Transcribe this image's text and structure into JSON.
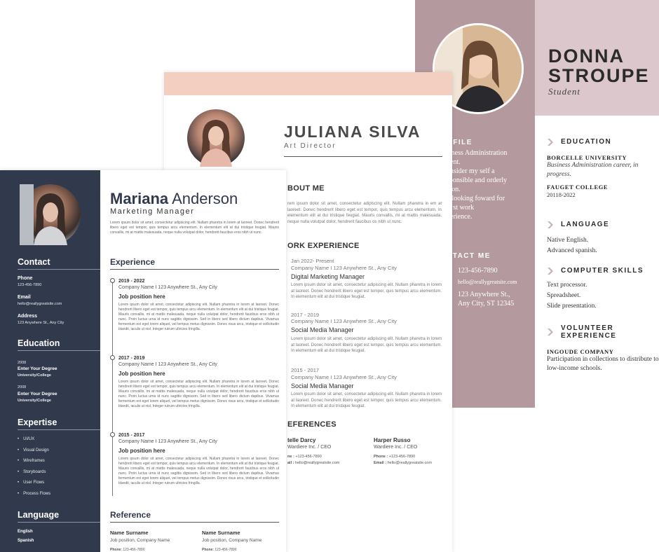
{
  "resume_c": {
    "name": "DONNA STROUPE",
    "role": "Student",
    "profile_head": "OFILE",
    "profile_lines": [
      "siness Administration",
      "dent.",
      "onsider my self a",
      "sponsible and orderly",
      "rson.",
      "n looking foward for",
      "first work",
      "perience."
    ],
    "contact_head": "NTACT ME",
    "contact_lines": [
      "123-456-7890",
      "hello@reallygreatsite.com",
      "123 Anywhere St.,",
      "Any City, ST 12345"
    ],
    "education": {
      "title": "EDUCATION",
      "school1": "BORCELLE UNIVERSITY",
      "detail1": "Business Administration career, in progress.",
      "school2": "FAUGET COLLEGE",
      "years2": "20118-2022"
    },
    "language": {
      "title": "LANGUAGE",
      "items": [
        "Native English.",
        "Advanced spanish."
      ]
    },
    "skills": {
      "title": "COMPUTER SKILLS",
      "items": [
        "Text processor.",
        "Spreadsheet.",
        "Slide presentation."
      ]
    },
    "volunteer": {
      "title": "VOLUNTEER EXPERIENCE",
      "org": "INGOUDE COMPANY",
      "detail": "Participation in collections to distribute to low-income schools."
    },
    "colors": {
      "sidebar": "#b49a9f",
      "header": "#dcc8cc"
    }
  },
  "resume_b": {
    "name": "JULIANA SILVA",
    "role": "Art Director",
    "about_head": "BOUT ME",
    "about_text": "rem ipsum dolor sit amet, consectetur adipiscing elit. Nullam pharetra in em at laoreet. Donec hendrerit libero eget est tempor, quis tempus arcu elementum. In elementum elit at dui tristique feugiat. Mauris convallis, mi at mattis malesuada, neque nulla volutpat dolor, hendrerit faucibus os nibh ut nunc.",
    "exp_head": "ORK EXPERIENCE",
    "jobs": [
      {
        "date": "Jan 2022- Present",
        "company": "Company Name I 123 Anywhere St., Any City",
        "title": "Digital Marketing Manager",
        "text": "Lorem ipsum dolor sit amet, consectetur adipiscing elit. Nullam pharetra in lorem at laoreet. Donec hendrerit libero eget est tempor, quis tempus arcu elementum. In elementum elit at dui tristique feugiat."
      },
      {
        "date": "2017 - 2019",
        "company": "Company Name I 123 Anywhere St., Any City",
        "title": "Social Media Manager",
        "text": "Lorem ipsum dolor sit amet, consectetur adipiscing elit. Nullam pharetra in lorem at laoreet. Donec hendrerit libero eget est tempor, quis tempus arcu elementum. In elementum elit at dui tristique feugiat."
      },
      {
        "date": "2015 - 2017",
        "company": "Company Name I 123 Anywhere St., Any City",
        "title": "Social Media Manager",
        "text": "Lorem ipsum dolor sit amet, consectetur adipiscing elit. Nullam pharetra in lorem at laoreet. Donec hendrerit libero eget est tempor, quis tempus arcu elementum. In elementum elit at dui tristique feugiat."
      }
    ],
    "ref_head": "EFERENCES",
    "refs": [
      {
        "name": "telle Darcy",
        "org": "Wardiere Inc. / CEO",
        "phone_label": "ne :",
        "phone": "+123-456-7890",
        "email_label": "ail :",
        "email": "hello@reallygreatsite.com"
      },
      {
        "name": "Harper Russo",
        "org": "Wardiere Inc. / CEO",
        "phone_label": "Phone :",
        "phone": "+123-456-7890",
        "email_label": "Email :",
        "email": "hello@reallygreatsite.com"
      }
    ],
    "colors": {
      "band": "#f2cfc1"
    }
  },
  "resume_a": {
    "first_name": "Mariana",
    "last_name": "Anderson",
    "role": "Marketing Manager",
    "intro": "Lorem ipsum dolor sit amet, consectetur adipiscing elit. Nullam pharetra in lorem at laoreet. Donec hendrerit libero eget est tempor, quis tempus arcu elementum. In elementum elit at dui tristique feugiat. Mauris convallis, mi at mattis malesuada, neque nulla volutpat dolor, hendrerit faucibus eros nibh ut nunc.",
    "contact": {
      "title": "Contact",
      "phone_label": "Phone",
      "phone": "123-456-7890",
      "email_label": "Email",
      "email": "hello@reallygreatsite.com",
      "address_label": "Address",
      "address": "123 Anywhere St., Any City"
    },
    "education": {
      "title": "Education",
      "entries": [
        {
          "year": "2008",
          "degree": "Enter Your Degree",
          "school": "University/College"
        },
        {
          "year": "2008",
          "degree": "Enter Your Degree",
          "school": "University/College"
        }
      ]
    },
    "expertise": {
      "title": "Expertise",
      "items": [
        "UI/UX",
        "Visual Design",
        "Wireframes",
        "Storyboards",
        "User Flows",
        "Process Flows"
      ]
    },
    "language": {
      "title": "Language",
      "items": [
        "English",
        "Spanish"
      ]
    },
    "experience_title": "Experience",
    "jobs": [
      {
        "years": "2019 - 2022",
        "company": "Company Name I 123 Anywhere St., Any City",
        "position": "Job position here",
        "text": "Lorem ipsum dolor sit amet, consectetur adipiscing elit. Nullam pharetra in lorem at laoreet. Donec hendrerit libero eget est tempor, quis tempus arcu elementum. In elementum elit at dui tristique feugiat. Mauris convallis, mi at mattis malesuada, neque nulla volutpat dolor, hendrerit faucibus eros nibh ut nunc. Proin luctus urna id nunc sagittis dignissim. Sed in libero sed libero dictum dapibus. Vivamus fermentum est eget lorem aliquet, vel tempus metus dignissim. Donec risus arcu, tristique et sollicitudin blandit, iaculis ut nisl. Integer rutrum ultricies fringilla."
      },
      {
        "years": "2017 - 2019",
        "company": "Company Name I 123 Anywhere St., Any City",
        "position": "Job position here",
        "text": "Lorem ipsum dolor sit amet, consectetur adipiscing elit. Nullam pharetra in lorem at laoreet. Donec hendrerit libero eget est tempor, quis tempus arcu elementum. In elementum elit at dui tristique feugiat. Mauris convallis, mi at mattis malesuada, neque nulla volutpat dolor, hendrerit faucibus eros nibh ut nunc. Proin luctus urna id nunc sagittis dignissim. Sed in libero sed libero dictum dapibus. Vivamus fermentum est eget lorem aliquet, vel tempus metus dignissim. Donec risus arcu, tristique et sollicitudin blandit, iaculis ut nisl. Integer rutrum ultricies fringilla."
      },
      {
        "years": "2015 - 2017",
        "company": "Company Name I 123 Anywhere St., Any City",
        "position": "Job position here",
        "text": "Lorem ipsum dolor sit amet, consectetur adipiscing elit. Nullam pharetra in lorem at laoreet. Donec hendrerit libero eget est tempor, quis tempus arcu elementum. In elementum elit at dui tristique feugiat. Mauris convallis, mi at mattis malesuada, neque nulla volutpat dolor, hendrerit faucibus eros nibh ut nunc. Proin luctus urna id nunc sagittis dignissim. Sed in libero sed libero dictum dapibus. Vivamus fermentum est eget lorem aliquet, vel tempus metus dignissim. Donec risus arcu, tristique et sollicitudin blandit, iaculis ut nisl. Integer rutrum ultricies fringilla."
      }
    ],
    "reference_title": "Reference",
    "refs": [
      {
        "name": "Name Surname",
        "position": "Job position, Company Name",
        "phone_label": "Phone:",
        "phone": "123-456-7890"
      },
      {
        "name": "Name Surname",
        "position": "Job position, Company Name",
        "phone_label": "Phone:",
        "phone": "123-456-7890"
      }
    ],
    "colors": {
      "sidebar": "#313a4d"
    }
  }
}
